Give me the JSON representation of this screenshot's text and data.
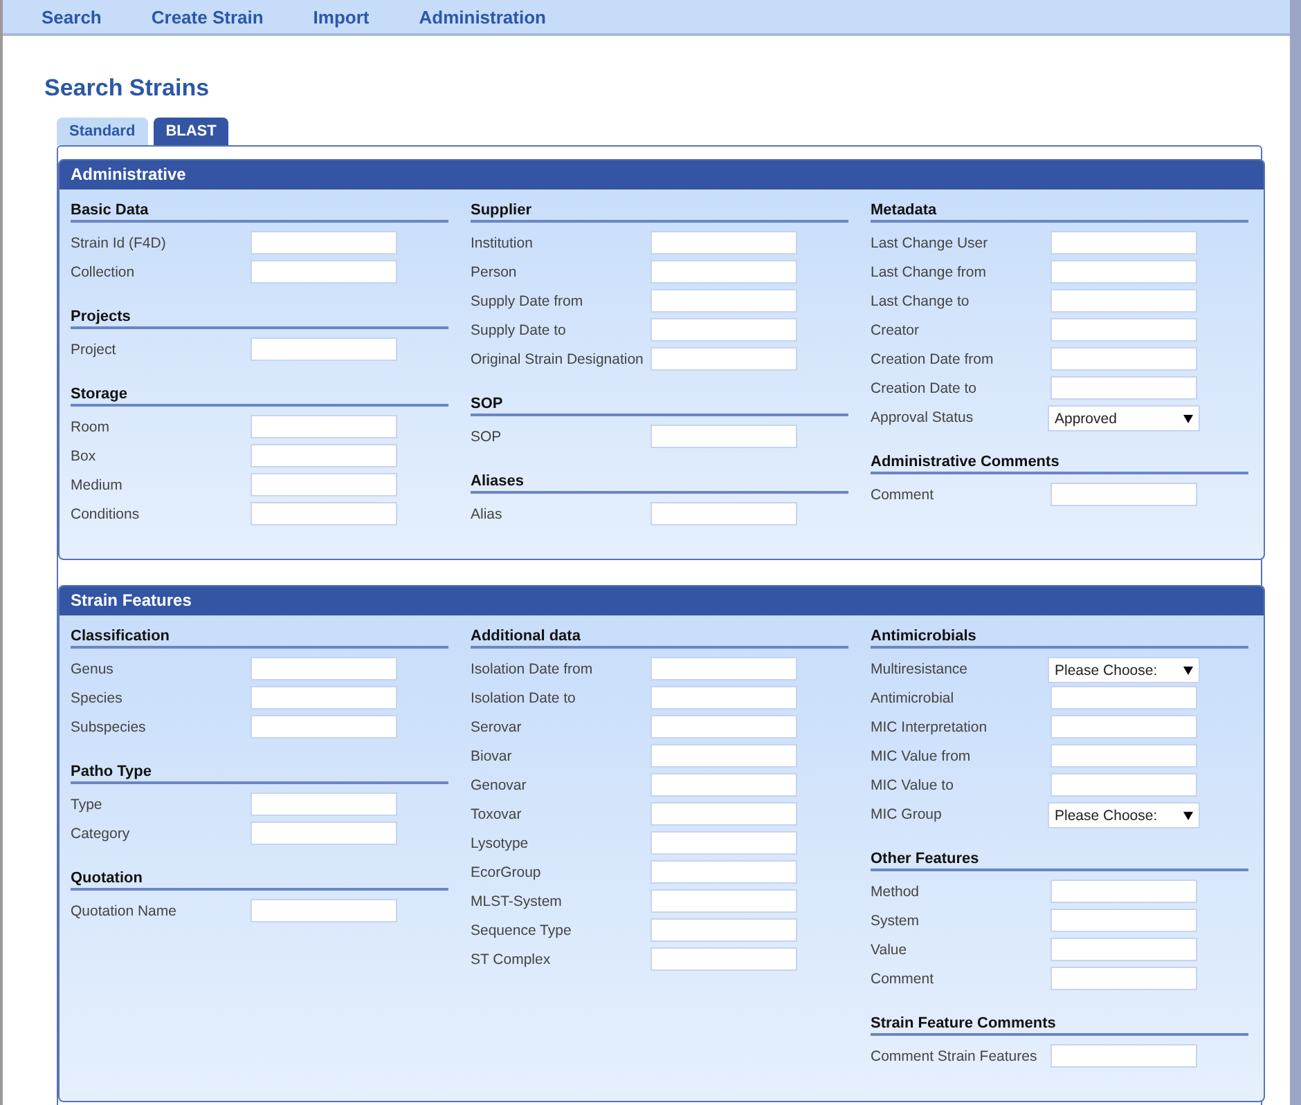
{
  "nav": [
    {
      "label": "Search"
    },
    {
      "label": "Create Strain"
    },
    {
      "label": "Import"
    },
    {
      "label": "Administration"
    }
  ],
  "title": "Search Strains",
  "tabs": [
    {
      "label": "Standard",
      "selected": false
    },
    {
      "label": "BLAST",
      "selected": true
    }
  ],
  "panels": [
    {
      "title": "Administrative",
      "columns": [
        [
          {
            "heading": "Basic Data",
            "fields": [
              {
                "label": "Strain Id (F4D)",
                "kind": "text"
              },
              {
                "label": "Collection",
                "kind": "text"
              }
            ]
          },
          {
            "heading": "Projects",
            "fields": [
              {
                "label": "Project",
                "kind": "text"
              }
            ]
          },
          {
            "heading": "Storage",
            "fields": [
              {
                "label": "Room",
                "kind": "text"
              },
              {
                "label": "Box",
                "kind": "text"
              },
              {
                "label": "Medium",
                "kind": "text"
              },
              {
                "label": "Conditions",
                "kind": "text"
              }
            ]
          }
        ],
        [
          {
            "heading": "Supplier",
            "fields": [
              {
                "label": "Institution",
                "kind": "text"
              },
              {
                "label": "Person",
                "kind": "text"
              },
              {
                "label": "Supply Date from",
                "kind": "text"
              },
              {
                "label": "Supply Date to",
                "kind": "text"
              },
              {
                "label": "Original Strain Designation",
                "kind": "text"
              }
            ]
          },
          {
            "heading": "SOP",
            "fields": [
              {
                "label": "SOP",
                "kind": "text"
              }
            ]
          },
          {
            "heading": "Aliases",
            "fields": [
              {
                "label": "Alias",
                "kind": "text"
              }
            ]
          }
        ],
        [
          {
            "heading": "Metadata",
            "fields": [
              {
                "label": "Last Change User",
                "kind": "text"
              },
              {
                "label": "Last Change from",
                "kind": "text"
              },
              {
                "label": "Last Change to",
                "kind": "text"
              },
              {
                "label": "Creator",
                "kind": "text"
              },
              {
                "label": "Creation Date from",
                "kind": "text"
              },
              {
                "label": "Creation Date to",
                "kind": "text"
              },
              {
                "label": "Approval Status",
                "kind": "select",
                "value": "Approved"
              }
            ]
          },
          {
            "heading": "Administrative Comments",
            "fields": [
              {
                "label": "Comment",
                "kind": "text"
              }
            ]
          }
        ]
      ]
    },
    {
      "title": "Strain Features",
      "columns": [
        [
          {
            "heading": "Classification",
            "fields": [
              {
                "label": "Genus",
                "kind": "text"
              },
              {
                "label": "Species",
                "kind": "text"
              },
              {
                "label": "Subspecies",
                "kind": "text"
              }
            ]
          },
          {
            "heading": "Patho Type",
            "fields": [
              {
                "label": "Type",
                "kind": "text"
              },
              {
                "label": "Category",
                "kind": "text"
              }
            ]
          },
          {
            "heading": "Quotation",
            "fields": [
              {
                "label": "Quotation Name",
                "kind": "text"
              }
            ]
          }
        ],
        [
          {
            "heading": "Additional data",
            "fields": [
              {
                "label": "Isolation Date from",
                "kind": "text"
              },
              {
                "label": "Isolation Date to",
                "kind": "text"
              },
              {
                "label": "Serovar",
                "kind": "text"
              },
              {
                "label": "Biovar",
                "kind": "text"
              },
              {
                "label": "Genovar",
                "kind": "text"
              },
              {
                "label": "Toxovar",
                "kind": "text"
              },
              {
                "label": "Lysotype",
                "kind": "text"
              },
              {
                "label": "EcorGroup",
                "kind": "text"
              },
              {
                "label": "MLST-System",
                "kind": "text"
              },
              {
                "label": "Sequence Type",
                "kind": "text"
              },
              {
                "label": "ST Complex",
                "kind": "text"
              }
            ]
          }
        ],
        [
          {
            "heading": "Antimicrobials",
            "fields": [
              {
                "label": "Multiresistance",
                "kind": "select",
                "value": "Please Choose:"
              },
              {
                "label": "Antimicrobial",
                "kind": "text"
              },
              {
                "label": "MIC Interpretation",
                "kind": "text"
              },
              {
                "label": "MIC Value from",
                "kind": "text"
              },
              {
                "label": "MIC Value to",
                "kind": "text"
              },
              {
                "label": "MIC Group",
                "kind": "select",
                "value": "Please Choose:"
              }
            ]
          },
          {
            "heading": "Other Features",
            "fields": [
              {
                "label": "Method",
                "kind": "text"
              },
              {
                "label": "System",
                "kind": "text"
              },
              {
                "label": "Value",
                "kind": "text"
              },
              {
                "label": "Comment",
                "kind": "text"
              }
            ]
          },
          {
            "heading": "Strain Feature Comments",
            "fields": [
              {
                "label": "Comment Strain Features",
                "kind": "text"
              }
            ]
          }
        ]
      ]
    }
  ]
}
